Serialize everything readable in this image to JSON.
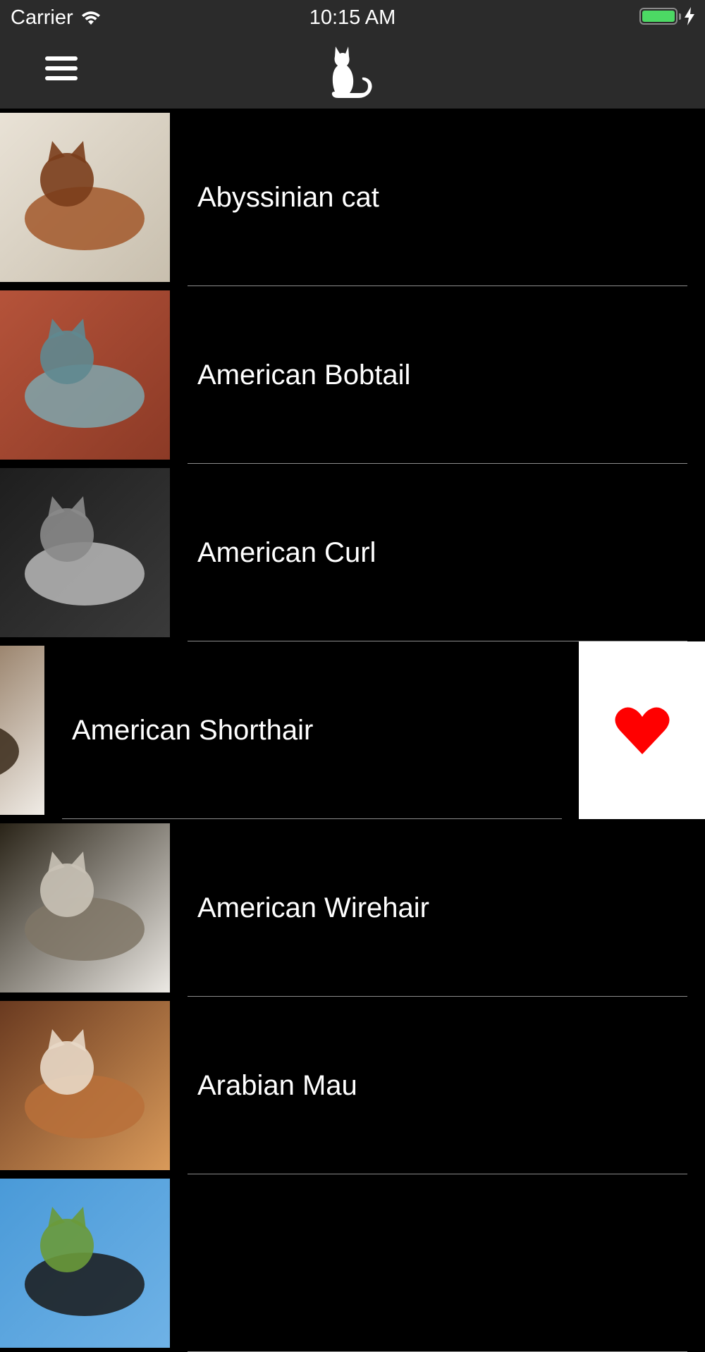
{
  "status_bar": {
    "carrier": "Carrier",
    "time": "10:15 AM",
    "battery_level": 1.0,
    "battery_color": "#4cd964"
  },
  "nav_bar": {
    "menu_icon": "hamburger-menu-icon",
    "logo_icon": "cat-silhouette-icon",
    "background": "#2b2b2b"
  },
  "breeds": [
    {
      "name": "Abyssinian cat",
      "thumb_colors": [
        "#e9e2d6",
        "#c8bfae",
        "#a2582a",
        "#7a3d1b"
      ]
    },
    {
      "name": "American Bobtail",
      "thumb_colors": [
        "#b5533a",
        "#8c3a26",
        "#7fa6ad",
        "#5f8890"
      ]
    },
    {
      "name": "American Curl",
      "thumb_colors": [
        "#1e1e1e",
        "#3a3a3a",
        "#b8b8b8",
        "#8a8a8a"
      ]
    },
    {
      "name": "American Shorthair",
      "swiped": true,
      "action_icon": "heart-icon",
      "action_color": "#ff0000",
      "thumb_colors": [
        "#6b4a2a",
        "#f0ece6",
        "#3a2a1a",
        "#a07a50"
      ]
    },
    {
      "name": "American Wirehair",
      "thumb_colors": [
        "#2a2418",
        "#ece9e4",
        "#7f7566",
        "#c9c2b6"
      ]
    },
    {
      "name": "Arabian Mau",
      "thumb_colors": [
        "#6a3a20",
        "#d99a5a",
        "#b8703a",
        "#e8d8c6"
      ]
    },
    {
      "name": "",
      "thumb_colors": [
        "#4a9ad8",
        "#6fb2e6",
        "#1a1a1a",
        "#6a9a3a"
      ]
    }
  ]
}
